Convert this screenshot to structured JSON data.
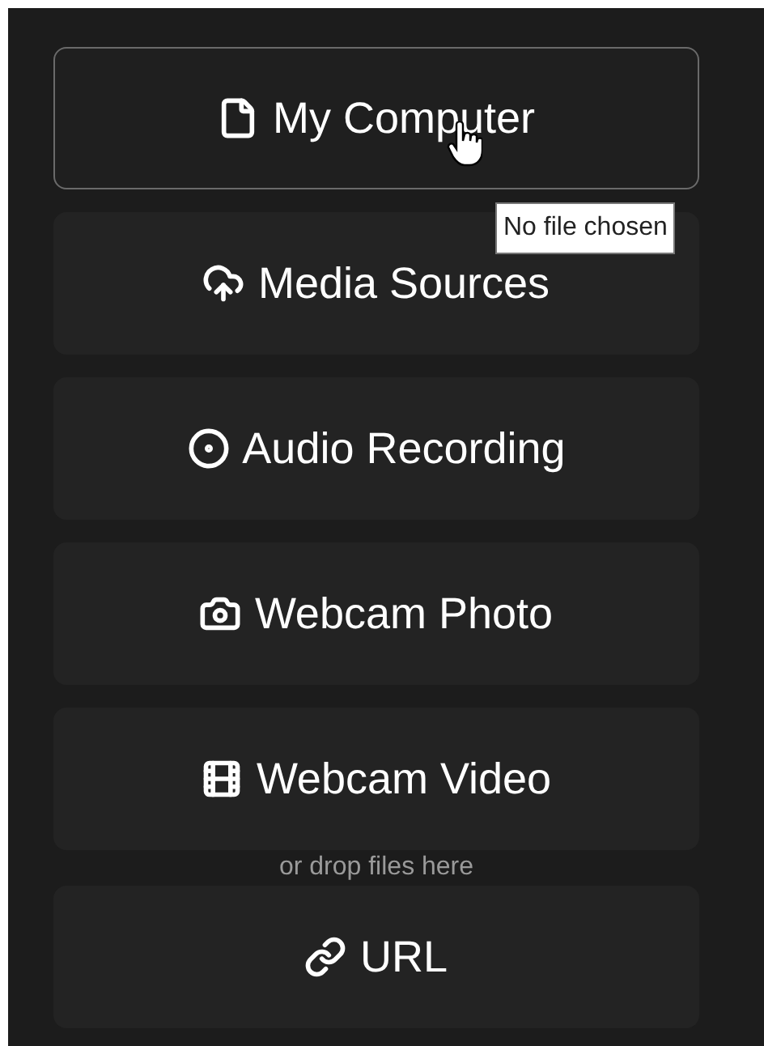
{
  "sources": [
    {
      "kind": "file",
      "label": "My Computer",
      "selected": true
    },
    {
      "kind": "cloud",
      "label": "Media Sources",
      "selected": false
    },
    {
      "kind": "record",
      "label": "Audio Recording",
      "selected": false
    },
    {
      "kind": "camera",
      "label": "Webcam Photo",
      "selected": false
    },
    {
      "kind": "film",
      "label": "Webcam Video",
      "selected": false
    },
    {
      "kind": "link",
      "label": "URL",
      "selected": false
    }
  ],
  "drop_hint": "or drop files here",
  "tooltip": "No file chosen"
}
